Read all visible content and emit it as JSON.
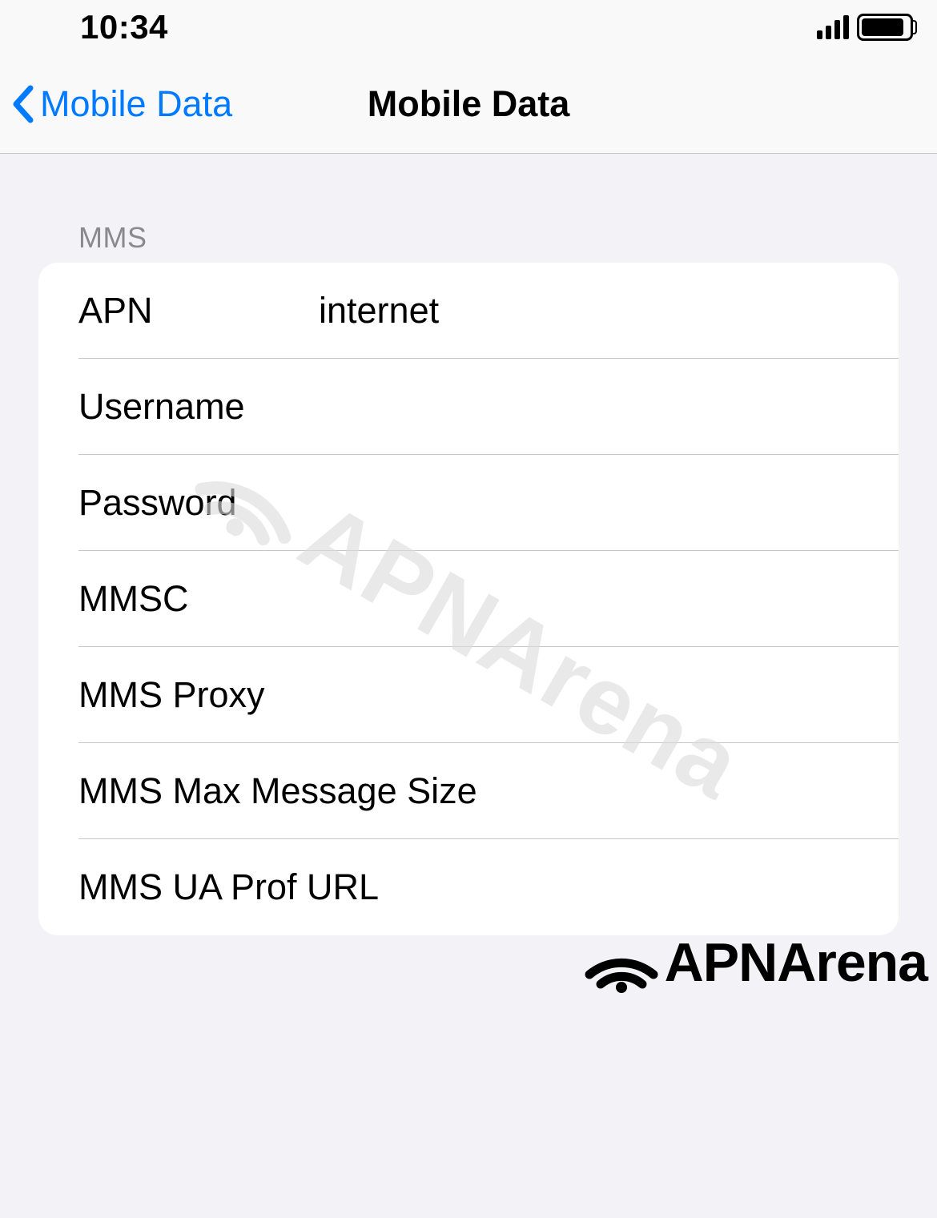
{
  "status_bar": {
    "time": "10:34"
  },
  "nav": {
    "back_label": "Mobile Data",
    "title": "Mobile Data"
  },
  "section": {
    "header": "MMS",
    "rows": [
      {
        "label": "APN",
        "value": "internet"
      },
      {
        "label": "Username",
        "value": ""
      },
      {
        "label": "Password",
        "value": ""
      },
      {
        "label": "MMSC",
        "value": ""
      },
      {
        "label": "MMS Proxy",
        "value": ""
      },
      {
        "label": "MMS Max Message Size",
        "value": ""
      },
      {
        "label": "MMS UA Prof URL",
        "value": ""
      }
    ]
  },
  "watermark": {
    "text": "APNArena"
  }
}
